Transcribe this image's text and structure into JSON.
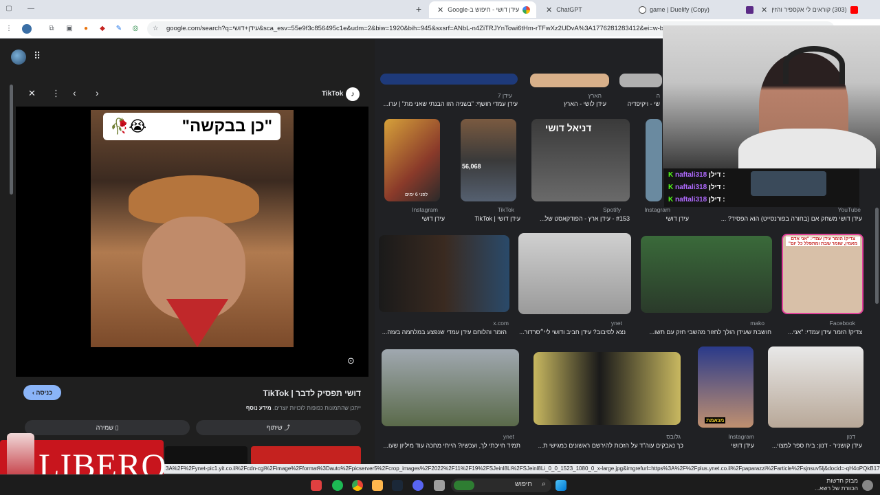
{
  "tabs": [
    {
      "label": "עידן דושי - חיפוש ב-Google",
      "active": true
    },
    {
      "label": "ChatGPT"
    },
    {
      "label": "game | Duelify (Copy)"
    },
    {
      "label": "(303) קוראים לי אקספיר והזין"
    }
  ],
  "address": {
    "url": "google.com/search?q=עידן+דושי&sca_esv=55e9f3c856495c1e&udm=2&biw=1920&bih=945&sxsrf=ANbL-n4ZiTRJYnTowi6tHm-rTFwXz2UDvA%3A1776281283412&ei=w-bfad"
  },
  "panel": {
    "source": "TikTok",
    "sticker_text": "\"כן בבקשה\"",
    "title": "דושי תפסיק לדבר | TikTok",
    "notice": "ייתכן שהתמונות כפופות לזכויות יוצרים.",
    "more_info": "מידע נוסף",
    "visit": "כניסה",
    "share": "שיתוף",
    "save": "שמירה"
  },
  "results": [
    {
      "src": "עידן 7",
      "title": "עידן עמדי חושף: \"בשניה הזו הבנתי שאני מת\" | ערו..."
    },
    {
      "src": "הארץ",
      "title": "עידן לושי - הארץ"
    },
    {
      "src": "ה",
      "title": "שי - ויקיפדיה"
    },
    {
      "src": "Instagram",
      "title": "עידן דושי",
      "overlay": "לפני 6 ימים"
    },
    {
      "src": "TikTok",
      "title": "עידן דושי | TikTok",
      "overlay": "56,068"
    },
    {
      "src": "Spotify",
      "title": "#153 - עידן ארץ - הפודקאסט של...",
      "overlay": "דניאל דושי"
    },
    {
      "src": "Instagram",
      "title": "עידן דושי"
    },
    {
      "src": "YouTube",
      "title": "עידן דושי משחק אם (בחורה בפורנסייט) הוא הפסיד? ..."
    },
    {
      "src": "x.com",
      "title": "הזמר והלוחם עידן עמדי שנפצע במלחמה בעזה..."
    },
    {
      "src": "ynet",
      "title": "נצא לסיבוב? עידן חביב ודושי ליי״סרדור..."
    },
    {
      "src": "mako",
      "title": "חושבת שעידן הולך לחזור מהשבי חזק עם תשו..."
    },
    {
      "src": "Facebook",
      "title": "צדיק! הזמר עידן עמדי: \"אני...",
      "overlay": "צדיק! הזמר עידן עמדי: \"אני אדם מאמין, שומר שבת ומתפלל כל יום\""
    },
    {
      "src": "ynet",
      "title": "תמיד חייכתי לך, ועכשיו? הייתי מחכה עוד מיליון שעו..."
    },
    {
      "src": "גלובס",
      "title": "כך נאבקים עוה\"ד על הזכות להירשם ראשונים כמגישי ת..."
    },
    {
      "src": "Instagram",
      "title": "עידן דושי",
      "overlay": "מנאמת"
    },
    {
      "src": "דנון",
      "title": "עידן קושניר - דנון: בית ספר למצוי..."
    }
  ],
  "chat": [
    {
      "user": "naftali318",
      "label": "דילן :"
    },
    {
      "user": "naftali318",
      "label": "דילן :"
    },
    {
      "user": "naftali318",
      "label": "דילן :"
    }
  ],
  "ad": {
    "brand": "LIBERO"
  },
  "status_url": "3A%2F%2Fynet-pic1.yit.co.il%2Fcdn-cgi%2Fimage%2Fformat%3Dauto%2Fpicserver5%2Fcrop_images%2F2022%2F11%2F19%2FSJeinl8Li%2FSJeinl8Li_0_0_1523_1080_0_x-large.jpg&imgrefurl=https%3A%2F%2Fplus.ynet.co.il%2Fpaparazzi%2Farticle%2Fsjnsuv5lj&docid=-qH4oPQkB17weM&...",
  "taskbar": {
    "search": "חיפוש",
    "news_title": "מבזק חדשות",
    "news_sub": "הכוורת של רשא..."
  },
  "colors": {
    "accent": "#8ab4f8",
    "background": "#202124",
    "tiktok": "#ffffff"
  }
}
